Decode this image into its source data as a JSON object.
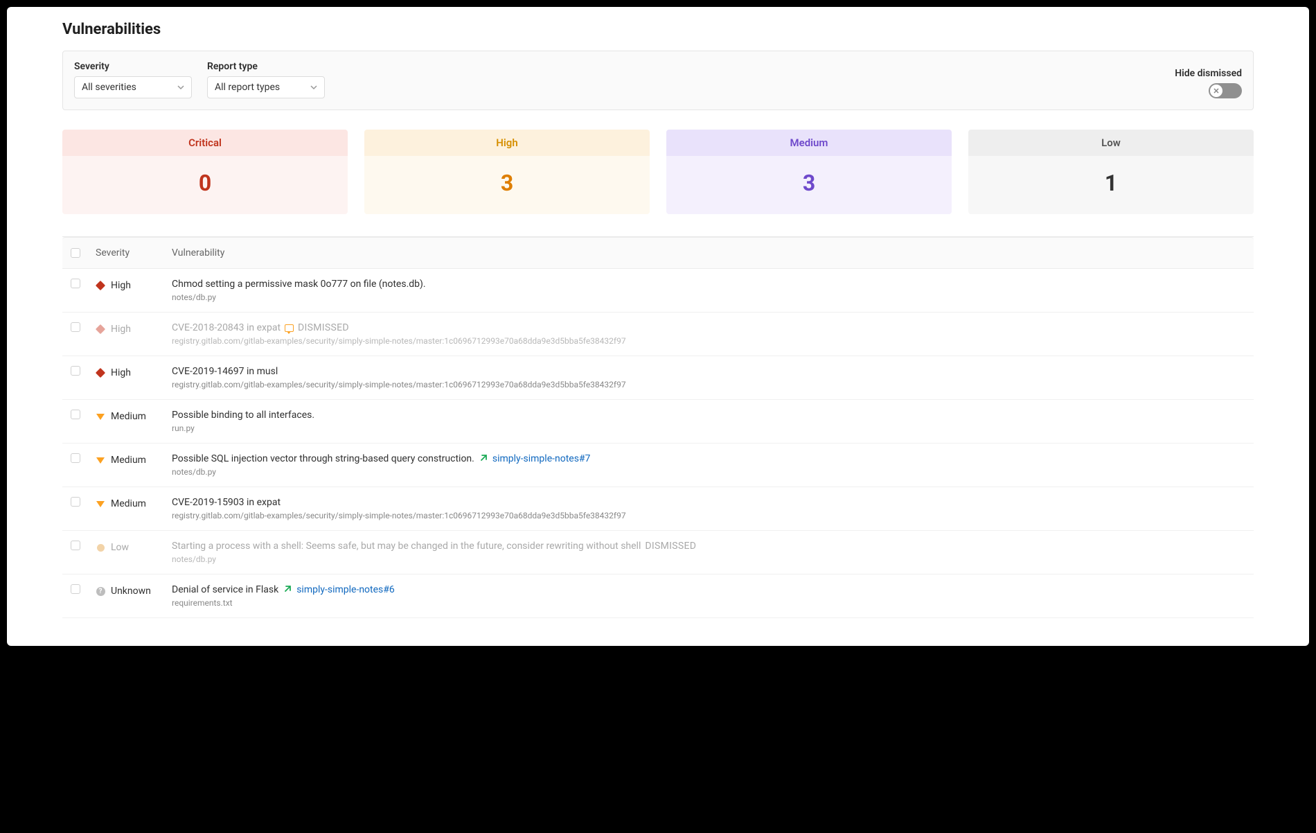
{
  "page": {
    "title": "Vulnerabilities"
  },
  "filters": {
    "severity_label": "Severity",
    "severity_value": "All severities",
    "report_label": "Report type",
    "report_value": "All report types",
    "hide_dismissed_label": "Hide dismissed"
  },
  "cards": {
    "critical": {
      "label": "Critical",
      "count": "0"
    },
    "high": {
      "label": "High",
      "count": "3"
    },
    "medium": {
      "label": "Medium",
      "count": "3"
    },
    "low": {
      "label": "Low",
      "count": "1"
    }
  },
  "table": {
    "head": {
      "severity": "Severity",
      "vulnerability": "Vulnerability"
    }
  },
  "rows": [
    {
      "severity": "High",
      "title": "Chmod setting a permissive mask 0o777 on file (notes.db).",
      "sub": "notes/db.py",
      "dismissed": false,
      "sev_icon": "diamond-red"
    },
    {
      "severity": "High",
      "title": "CVE-2018-20843 in expat",
      "sub": "registry.gitlab.com/gitlab-examples/security/simply-simple-notes/master:1c0696712993e70a68dda9e3d5bba5fe38432f97",
      "dismissed": true,
      "dismissed_label": "DISMISSED",
      "sev_icon": "diamond-red-faded",
      "has_comment": true
    },
    {
      "severity": "High",
      "title": "CVE-2019-14697 in musl",
      "sub": "registry.gitlab.com/gitlab-examples/security/simply-simple-notes/master:1c0696712993e70a68dda9e3d5bba5fe38432f97",
      "dismissed": false,
      "sev_icon": "diamond-red"
    },
    {
      "severity": "Medium",
      "title": "Possible binding to all interfaces.",
      "sub": "run.py",
      "dismissed": false,
      "sev_icon": "triangle-orange"
    },
    {
      "severity": "Medium",
      "title": "Possible SQL injection vector through string-based query construction.",
      "sub": "notes/db.py",
      "dismissed": false,
      "sev_icon": "triangle-orange",
      "issue": "simply-simple-notes#7"
    },
    {
      "severity": "Medium",
      "title": "CVE-2019-15903 in expat",
      "sub": "registry.gitlab.com/gitlab-examples/security/simply-simple-notes/master:1c0696712993e70a68dda9e3d5bba5fe38432f97",
      "dismissed": false,
      "sev_icon": "triangle-orange"
    },
    {
      "severity": "Low",
      "title": "Starting a process with a shell: Seems safe, but may be changed in the future, consider rewriting without shell",
      "sub": "notes/db.py",
      "dismissed": true,
      "dismissed_label": "DISMISSED",
      "sev_icon": "dot-beige"
    },
    {
      "severity": "Unknown",
      "title": "Denial of service in Flask",
      "sub": "requirements.txt",
      "dismissed": false,
      "sev_icon": "qmark",
      "issue": "simply-simple-notes#6"
    }
  ]
}
